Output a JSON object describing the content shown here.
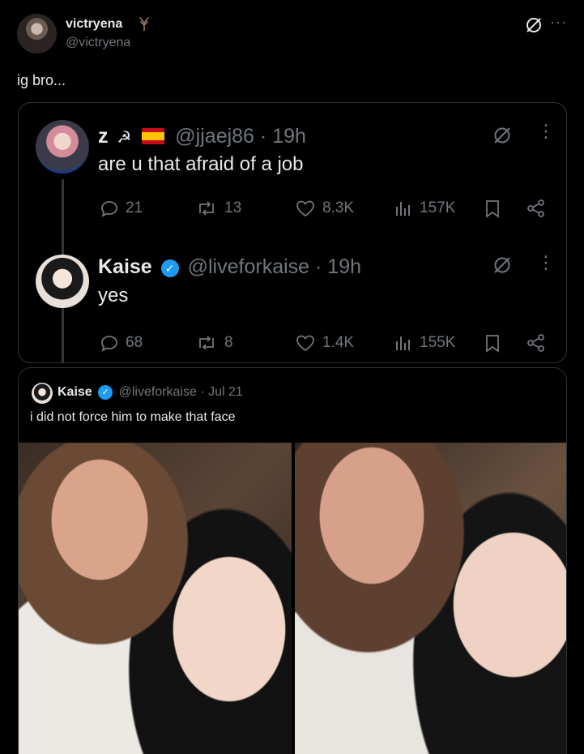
{
  "post": {
    "author_name": "victryena",
    "author_badge": "tree-emoji",
    "author_handle": "@victryena",
    "text": "ig bro..."
  },
  "quoted_thread": {
    "tweets": [
      {
        "name": "z",
        "emojis": "☭",
        "handle": "@jjaej86",
        "time": "· 19h",
        "text": "are u that afraid of a job",
        "replies": "21",
        "reposts": "13",
        "likes": "8.3K",
        "views": "157K"
      },
      {
        "name": "Kaise",
        "verified": true,
        "handle": "@liveforkaise",
        "time": "· 19h",
        "text": "yes",
        "replies": "68",
        "reposts": "8",
        "likes": "1.4K",
        "views": "155K"
      }
    ]
  },
  "quoted_post": {
    "name": "Kaise",
    "verified": true,
    "handle": "@liveforkaise",
    "date": "· Jul 21",
    "text": "i did not force him to make that face",
    "images": [
      "photo-left",
      "photo-right"
    ]
  },
  "icons": {
    "grok": "grok-icon",
    "more": "more-icon",
    "reply": "reply-icon",
    "repost": "repost-icon",
    "like": "heart-icon",
    "views": "views-icon",
    "bookmark": "bookmark-icon",
    "share": "share-icon"
  },
  "colors": {
    "background": "#000000",
    "text": "#e7e9ea",
    "muted": "#71767b",
    "border": "#2f3336",
    "verified": "#1d9bf0"
  }
}
